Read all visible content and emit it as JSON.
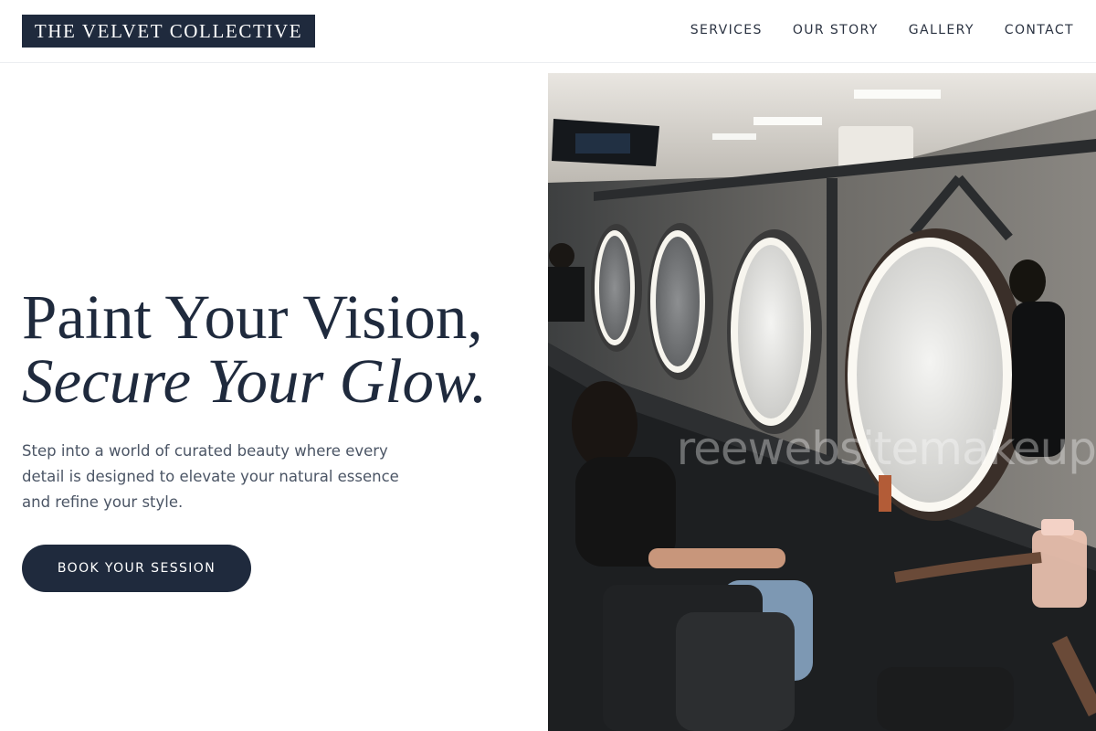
{
  "header": {
    "logo": "THE VELVET COLLECTIVE",
    "nav": [
      {
        "label": "SERVICES"
      },
      {
        "label": "OUR STORY"
      },
      {
        "label": "GALLERY"
      },
      {
        "label": "CONTACT"
      }
    ]
  },
  "hero": {
    "title_line1": "Paint Your Vision,",
    "title_line2": "Secure Your Glow.",
    "subtitle": "Step into a world of curated beauty where every detail is designed to elevate your natural essence and refine your style.",
    "cta_label": "BOOK YOUR SESSION"
  },
  "image": {
    "watermark": "reewebsitemakeup"
  },
  "colors": {
    "navy": "#1f2a3d",
    "text_muted": "#4b5565",
    "background": "#ffffff"
  }
}
